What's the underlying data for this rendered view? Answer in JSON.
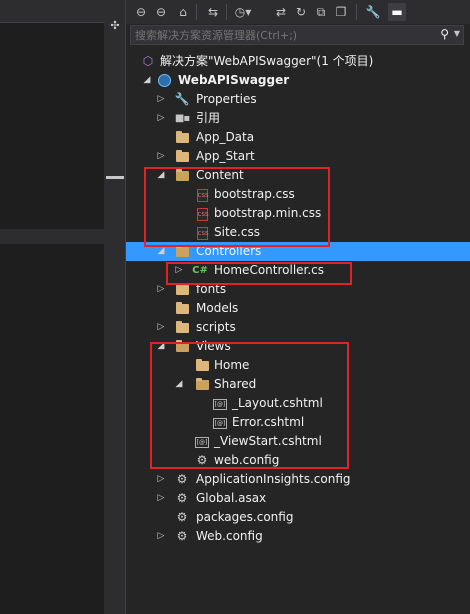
{
  "search": {
    "placeholder": "搜索解决方案资源管理器(Ctrl+;)"
  },
  "toolbar": {
    "buttons": [
      "back-icon",
      "forward-icon",
      "home-icon",
      "sync-icon",
      "history-icon",
      "pending-changes-icon",
      "refresh-icon",
      "collapse-icon",
      "copy-icon",
      "properties-icon",
      "pin-icon"
    ]
  },
  "tree": {
    "solution": "解决方案\"WebAPISwagger\"(1 个项目)",
    "project": "WebAPISwagger",
    "items": [
      {
        "label": "Properties"
      },
      {
        "label": "引用"
      },
      {
        "label": "App_Data"
      },
      {
        "label": "App_Start"
      },
      {
        "label": "Content"
      },
      {
        "label": "bootstrap.css"
      },
      {
        "label": "bootstrap.min.css"
      },
      {
        "label": "Site.css"
      },
      {
        "label": "Controllers"
      },
      {
        "label": "HomeController.cs"
      },
      {
        "label": "fonts"
      },
      {
        "label": "Models"
      },
      {
        "label": "scripts"
      },
      {
        "label": "Views"
      },
      {
        "label": "Home"
      },
      {
        "label": "Shared"
      },
      {
        "label": "_Layout.cshtml"
      },
      {
        "label": "Error.cshtml"
      },
      {
        "label": "_ViewStart.cshtml"
      },
      {
        "label": "web.config"
      },
      {
        "label": "ApplicationInsights.config"
      },
      {
        "label": "Global.asax"
      },
      {
        "label": "packages.config"
      },
      {
        "label": "Web.config"
      }
    ]
  },
  "icons": {
    "cs_badge": "C#",
    "css_badge": "css",
    "cshtml_badge": "[@]"
  },
  "colors": {
    "selection": "#3399ff",
    "annotation": "#e02424",
    "folder": "#dcb67a"
  }
}
